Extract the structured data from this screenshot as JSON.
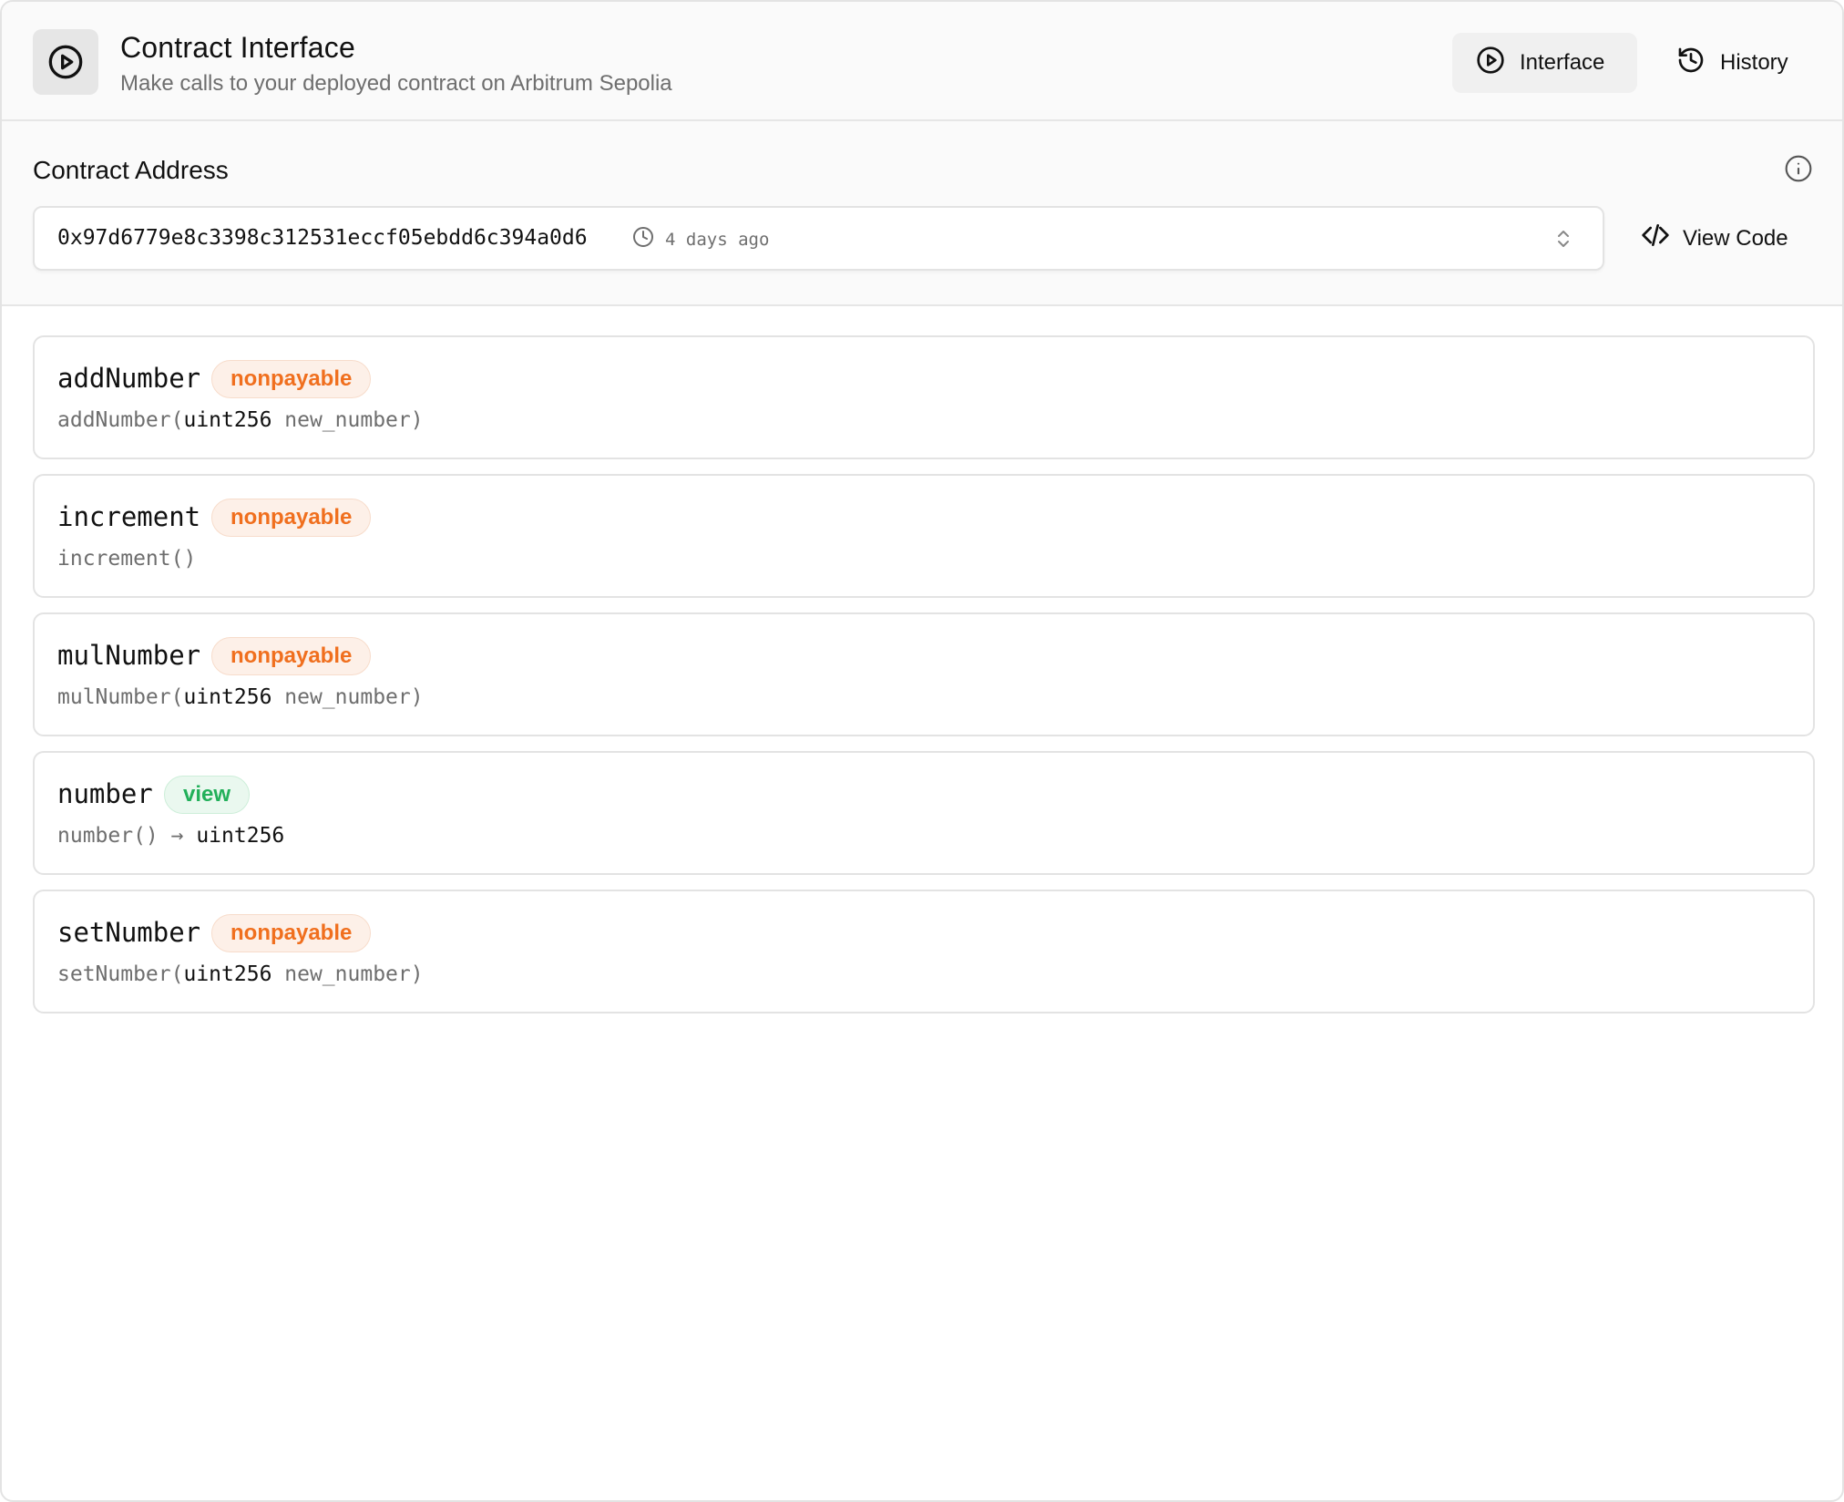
{
  "header": {
    "icon": "play-circle-icon",
    "title": "Contract Interface",
    "subtitle": "Make calls to your deployed contract on Arbitrum Sepolia",
    "tabs": [
      {
        "label": "Interface",
        "icon": "play-circle-icon",
        "active": true
      },
      {
        "label": "History",
        "icon": "history-icon",
        "active": false
      }
    ]
  },
  "address": {
    "label": "Contract Address",
    "value": "0x97d6779e8c3398c312531eccf05ebdd6c394a0d6",
    "time": "4 days ago",
    "view_code_label": "View Code"
  },
  "functions": [
    {
      "name": "addNumber",
      "badge": "nonpayable",
      "sig_prefix": "addNumber(",
      "sig_type": "uint256",
      "sig_rest": " new_number)"
    },
    {
      "name": "increment",
      "badge": "nonpayable",
      "sig_prefix": "increment()",
      "sig_type": "",
      "sig_rest": ""
    },
    {
      "name": "mulNumber",
      "badge": "nonpayable",
      "sig_prefix": "mulNumber(",
      "sig_type": "uint256",
      "sig_rest": " new_number)"
    },
    {
      "name": "number",
      "badge": "view",
      "sig_prefix": "number() → ",
      "sig_type": "uint256",
      "sig_rest": ""
    },
    {
      "name": "setNumber",
      "badge": "nonpayable",
      "sig_prefix": "setNumber(",
      "sig_type": "uint256",
      "sig_rest": " new_number)"
    }
  ],
  "colors": {
    "nonpayable": "#f06f1e",
    "view": "#22b05a"
  }
}
